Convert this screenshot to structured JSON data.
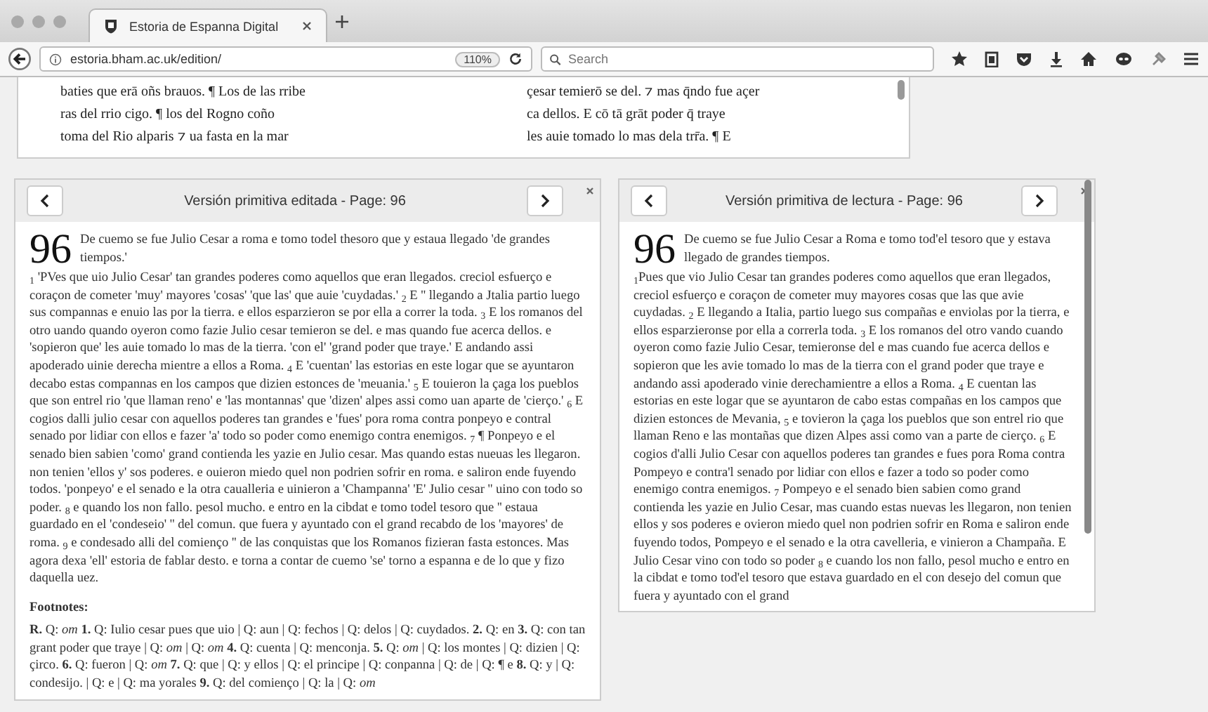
{
  "browser": {
    "tab": {
      "title": "Estoria de Espanna Digital",
      "selected": true
    },
    "url": "estoria.bham.ac.uk/edition/",
    "zoom": "110%",
    "search": {
      "placeholder": "Search"
    }
  },
  "manuscript": {
    "columns": [
      [
        "baties que erā oñs brauos. ¶ Los de las rribe",
        "ras del rrio cigo. ¶ los del Rogno coño",
        "toma del Rio alparis ⁊ ua fasta en la mar"
      ],
      [
        "çesar temierō se del. ⁊ mas q̄ndo fue açer",
        "ca dellos. E cō tā grāt poder q̄ traye",
        "les auie tomado lo mas dela trr̄a. ¶ E"
      ]
    ]
  },
  "panels": [
    {
      "title": "Versión primitiva editada - Page: 96",
      "page_number": "96",
      "heading": "De cuemo se fue Julio Cesar a roma e tomo todel thesoro que y estaua llegado 'de grandes tiempos.'",
      "body": "$_{1}$ 'PVes que uio Julio Cesar' tan grandes poderes como aquellos que eran llegados. creciol esfuerço e coraçon de cometer 'muy' mayores 'cosas' 'que las' que auie 'cuydadas.' $_{2}$ E '' llegando a Jtalia partio luego sus compannas e enuio las por la tierra. e ellos esparzieron se por ella a correr la toda. $_{3}$ E los romanos del otro uando quando oyeron como fazie Julio cesar temieron se del. e mas quando fue acerca dellos. e 'sopieron que' les auie tomado lo mas de la tierra. 'con el' 'grand poder que traye.' E andando assi apoderado uinie derecha mientre a ellos a Roma. $_{4}$ E 'cuentan' las estorias en este logar que se ayuntaron decabo estas compannas en los campos que dizien estonces de 'meuania.' $_{5}$ E touieron la çaga los pueblos que son entrel rio 'que llaman reno' e 'las montannas' que 'dizen' alpes assi como uan aparte de 'cierço.' $_{6}$ E cogios dalli julio cesar con aquellos poderes tan grandes e 'fues' pora roma contra ponpeyo e contral senado por lidiar con ellos e fazer 'a' todo so poder como enemigo contra enemigos. $_{7}$ ¶ Ponpeyo e el senado bien sabien 'como' grand contienda les yazie en Julio cesar. Mas quando estas nueuas les llegaron. non tenien 'ellos y' sos poderes. e ouieron miedo quel non podrien sofrir en roma. e saliron ende fuyendo todos. 'ponpeyo' e el senado e la otra caualleria e uinieron a 'Champanna' 'E' Julio cesar '' uino con todo so poder. $_{8}$ e quando los non fallo. pesol mucho. e entro en la cibdat e tomo todel tesoro que '' estaua guardado en el 'condeseio' '' del comun. que fuera y ayuntado con el grand recabdo de los 'mayores' de roma. $_{9}$ e condesado alli del comienço '' de las conquistas que los Romanos fizieran fasta estonces. Mas agora dexa 'ell' estoria de fablar desto. e torna a contar de cuemo 'se' torno a espanna e de lo que y fizo daquella uez.",
      "footnotes": {
        "label": "Footnotes:",
        "text": "**R.** Q: *om* **1.** Q: Iulio cesar pues que uio | Q: aun | Q: fechos | Q: delos | Q: cuydados. **2.** Q: en **3.** Q: con tan grant poder que traye | Q: *om* | Q: *om* **4.** Q: cuenta | Q: menconja. **5.** Q: *om* | Q: los montes | Q: dizien | Q: çirco. **6.** Q: fueron | Q: *om* **7.** Q: que | Q: y ellos | Q: el principe | Q: conpanna | Q: de | Q: ¶ e **8.** Q: y | Q: condesijo. | Q: e | Q: ma yorales **9.** Q: del comienço | Q: la | Q: *om*"
      }
    },
    {
      "title": "Versión primitiva de lectura - Page: 96",
      "page_number": "96",
      "heading": "De cuemo se fue Julio Cesar a Roma e tomo tod'el tesoro que y estava llegado de grandes tiempos.",
      "body": "$_{1}$Pues que vio Julio Cesar tan grandes poderes como aquellos que eran llegados, creciol esfuerço e coraçon de cometer muy mayores cosas que las que avie cuydadas. $_{2}$ E llegando a Italia, partio luego sus compañas e enviolas por la tierra, e ellos esparzieronse por ella a correrla toda. $_{3}$ E los romanos del otro vando cuando oyeron como fazie Julio Cesar, temieronse del e mas cuando fue acerca dellos e sopieron que les avie tomado lo mas de la tierra con el grand poder que traye e andando assi apoderado vinie derechamientre a ellos a Roma. $_{4}$ E cuentan las estorias en este logar que se ayuntaron de cabo estas compañas en los campos que dizien estonces de Mevania, $_{5}$ e tovieron la çaga los pueblos que son entrel rio que llaman Reno e las montañas que dizen Alpes assi como van a parte de cierço. $_{6}$ E cogios d'alli Julio Cesar con aquellos poderes tan grandes e fues pora Roma contra Pompeyo e contra'l senado por lidiar con ellos e fazer a todo so poder como enemigo contra enemigos. $_{7}$ Pompeyo e el senado bien sabien como grand contienda les yazie en Julio Cesar, mas cuando estas nuevas les llegaron, non tenien ellos y sos poderes e ovieron miedo quel non podrien sofrir en Roma e saliron ende fuyendo todos, Pompeyo e el senado e la otra cavelleria, e vinieron a Champaña. E Julio Cesar vino con todo so poder $_{8}$ e cuando los non fallo, pesol mucho e entro en la cibdat e tomo tod'el tesoro que estava guardado en el con desejo del comun que fuera y ayuntado con el grand"
    }
  ]
}
